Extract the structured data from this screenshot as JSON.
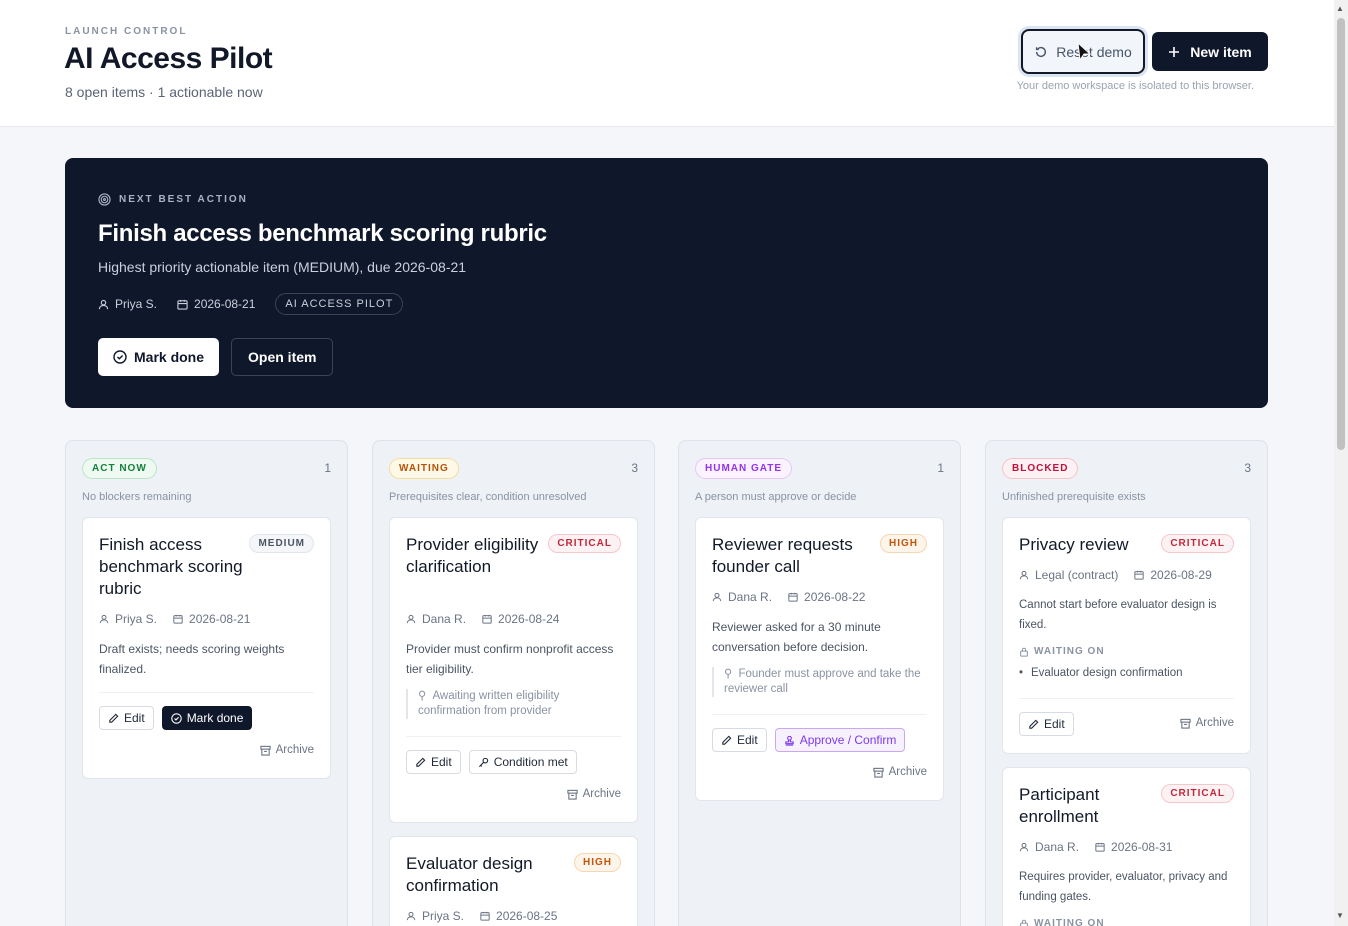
{
  "header": {
    "eyebrow": "LAUNCH CONTROL",
    "title": "AI Access Pilot",
    "subtitle": "8 open items · 1 actionable now",
    "reset_label": "Reset demo",
    "new_label": "New item",
    "isolation_note": "Your demo workspace is isolated to this browser."
  },
  "hero": {
    "eyebrow": "NEXT BEST ACTION",
    "title": "Finish access benchmark scoring rubric",
    "description": "Highest priority actionable item (MEDIUM), due 2026-08-21",
    "owner": "Priya S.",
    "due": "2026-08-21",
    "tag": "AI ACCESS PILOT",
    "primary_label": "Mark done",
    "secondary_label": "Open item"
  },
  "columns": [
    {
      "badge": "ACT NOW",
      "count": "1",
      "description": "No blockers remaining",
      "color": "#15803d",
      "cards": [
        {
          "title": "Finish access benchmark scoring rubric",
          "priority": "MEDIUM",
          "owner": "Priya S.",
          "due": "2026-08-21",
          "description": "Draft exists; needs scoring weights finalized.",
          "edit": "Edit",
          "action": "Mark done",
          "archive": "Archive"
        }
      ]
    },
    {
      "badge": "WAITING",
      "count": "3",
      "description": "Prerequisites clear, condition unresolved",
      "color": "#b45309",
      "cards": [
        {
          "title": "Provider eligibility clarification",
          "priority": "CRITICAL",
          "owner": "Dana R.",
          "due": "2026-08-24",
          "description": "Provider must confirm nonprofit access tier eligibility.",
          "note": "Awaiting written eligibility confirmation from provider",
          "edit": "Edit",
          "action": "Condition met",
          "archive": "Archive"
        },
        {
          "title": "Evaluator design confirmation",
          "priority": "HIGH",
          "owner": "Priya S.",
          "due": "2026-08-25"
        }
      ]
    },
    {
      "badge": "HUMAN GATE",
      "count": "1",
      "description": "A person must approve or decide",
      "color": "#9333ea",
      "cards": [
        {
          "title": "Reviewer requests founder call",
          "priority": "HIGH",
          "owner": "Dana R.",
          "due": "2026-08-22",
          "description": "Reviewer asked for a 30 minute conversation before decision.",
          "note": "Founder must approve and take the reviewer call",
          "edit": "Edit",
          "action": "Approve / Confirm",
          "archive": "Archive"
        }
      ]
    },
    {
      "badge": "BLOCKED",
      "count": "3",
      "description": "Unfinished prerequisite exists",
      "color": "#be123c",
      "cards": [
        {
          "title": "Privacy review",
          "priority": "CRITICAL",
          "owner": "Legal (contract)",
          "due": "2026-08-29",
          "description": "Cannot start before evaluator design is fixed.",
          "waiting_label": "WAITING ON",
          "waiting_item": "Evaluator design confirmation",
          "edit": "Edit",
          "archive": "Archive"
        },
        {
          "title": "Participant enrollment",
          "priority": "CRITICAL",
          "owner": "Dana R.",
          "due": "2026-08-31",
          "description": "Requires provider, evaluator, privacy and funding gates.",
          "waiting_label": "WAITING ON"
        }
      ]
    }
  ]
}
